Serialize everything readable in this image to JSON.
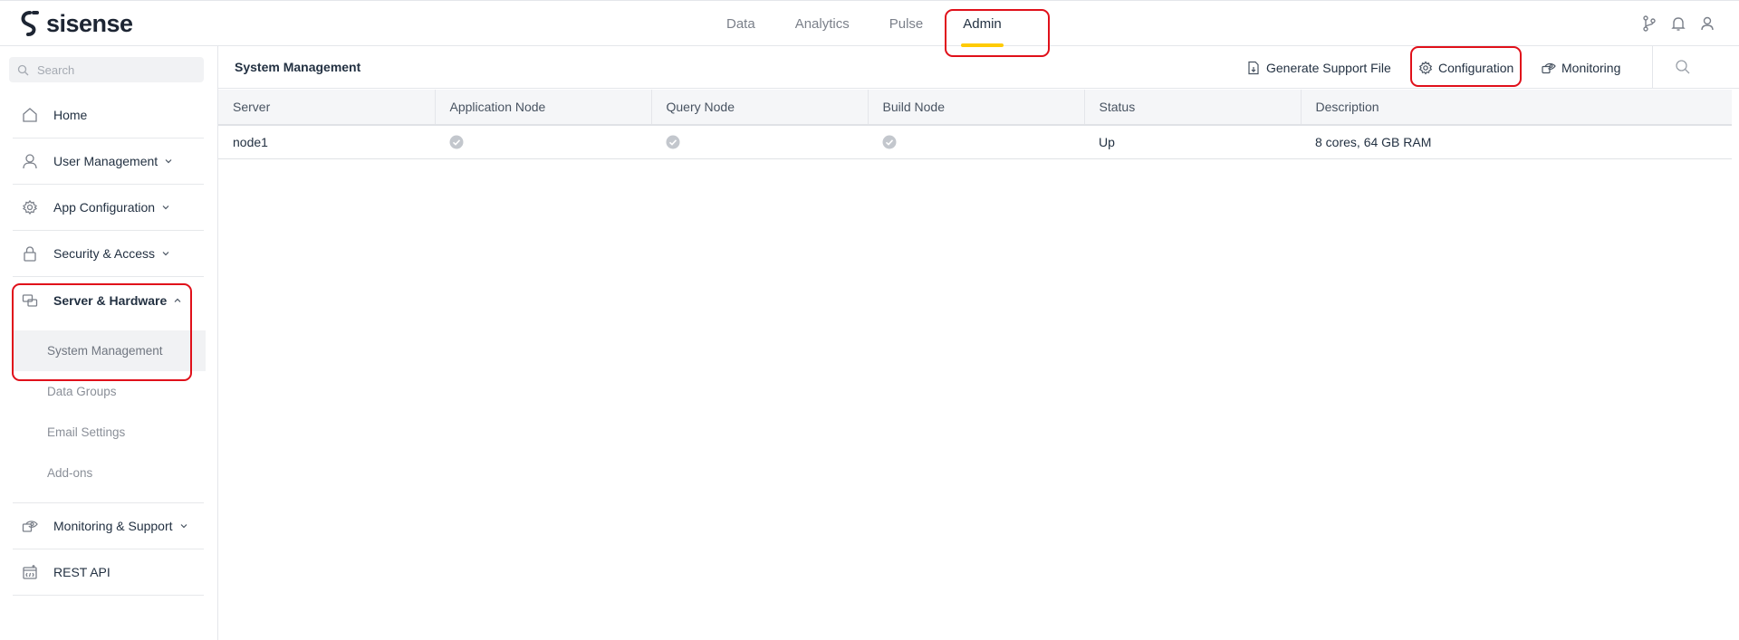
{
  "app": {
    "brand": "sisense"
  },
  "nav": {
    "tabs": [
      {
        "label": "Data"
      },
      {
        "label": "Analytics"
      },
      {
        "label": "Pulse"
      },
      {
        "label": "Admin",
        "active": true
      }
    ]
  },
  "top_icons": [
    "branch-icon",
    "bell-icon",
    "user-icon"
  ],
  "sidebar": {
    "search": {
      "placeholder": "Search"
    },
    "items": [
      {
        "label": "Home",
        "icon": "home-icon"
      },
      {
        "label": "User Management",
        "icon": "user-icon",
        "expandable": true
      },
      {
        "label": "App Configuration",
        "icon": "gear-icon",
        "expandable": true
      },
      {
        "label": "Security & Access",
        "icon": "lock-icon",
        "expandable": true
      },
      {
        "label": "Server & Hardware",
        "icon": "server-icon",
        "expanded": true,
        "children": [
          {
            "label": "System Management",
            "active": true
          },
          {
            "label": "Data Groups"
          },
          {
            "label": "Email Settings"
          },
          {
            "label": "Add-ons"
          }
        ]
      },
      {
        "label": "Monitoring & Support",
        "icon": "monitor-eye-icon",
        "expandable": true
      },
      {
        "label": "REST API",
        "icon": "api-icon"
      }
    ]
  },
  "main": {
    "title": "System Management",
    "actions": {
      "support": "Generate Support File",
      "configuration": "Configuration",
      "monitoring": "Monitoring"
    },
    "table": {
      "columns": [
        "Server",
        "Application Node",
        "Query Node",
        "Build Node",
        "Status",
        "Description"
      ],
      "rows": [
        {
          "server": "node1",
          "application_node": true,
          "query_node": true,
          "build_node": true,
          "status": "Up",
          "description": "8 cores, 64 GB RAM"
        }
      ]
    }
  },
  "colors": {
    "accent": "#ffcb05",
    "highlight": "#e0101a",
    "text": "#233142",
    "muted": "#8a8f98"
  }
}
